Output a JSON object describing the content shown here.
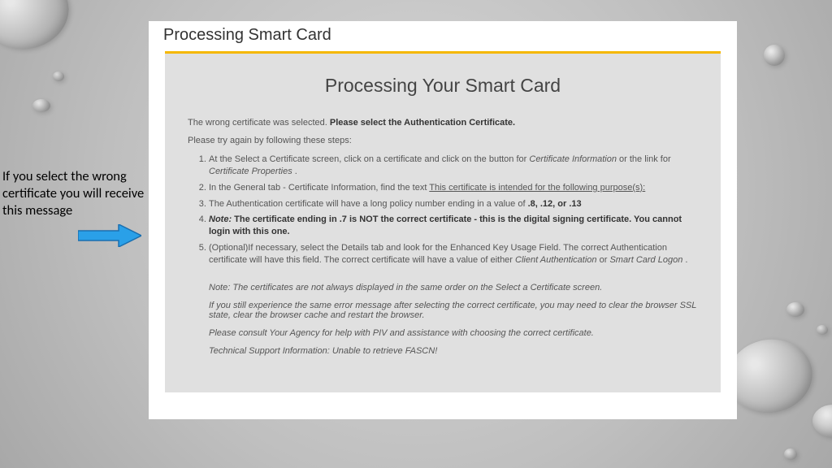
{
  "annotation": {
    "text": "If you select the wrong certificate you will receive this message"
  },
  "card": {
    "outer_title": "Processing Smart Card",
    "title": "Processing Your Smart Card",
    "error_prefix": "The wrong certificate was selected. ",
    "error_bold": "Please select the Authentication Certificate.",
    "intro": "Please try again by following these steps:",
    "steps": {
      "s1a": "At the Select a Certificate screen, click on a certificate and click on the button for ",
      "s1b": "Certificate Information",
      "s1c": " or the link for ",
      "s1d": "Certificate Properties",
      "s1e": " .",
      "s2a": "In the General tab - Certificate Information, find the text ",
      "s2b": "This certificate is intended for the following purpose(s):",
      "s3a": "The Authentication certificate will have a long policy number ending in a value of ",
      "s3b": ".8, .12, or .13",
      "s4a": "Note:",
      "s4b": " The certificate ending in .7 is NOT the correct certificate - this is the digital signing certificate. You cannot login with this one.",
      "s5a": "(Optional)If necessary, select the Details tab and look for the Enhanced Key Usage Field. The correct Authentication certificate will have this field. The correct certificate will have a value of either ",
      "s5b": "Client Authentication",
      "s5c": " or ",
      "s5d": "Smart Card Logon",
      "s5e": " ."
    },
    "notes": {
      "n1": "Note: The certificates are not always displayed in the same order on the Select a Certificate screen.",
      "n2": "If you still experience the same error message after selecting the correct certificate, you may need to clear the browser SSL state, clear the browser cache and restart the browser.",
      "n3": "Please consult Your Agency for help with PIV and assistance with choosing the correct certificate.",
      "tech": "Technical Support Information: Unable to retrieve FASCN!"
    }
  }
}
